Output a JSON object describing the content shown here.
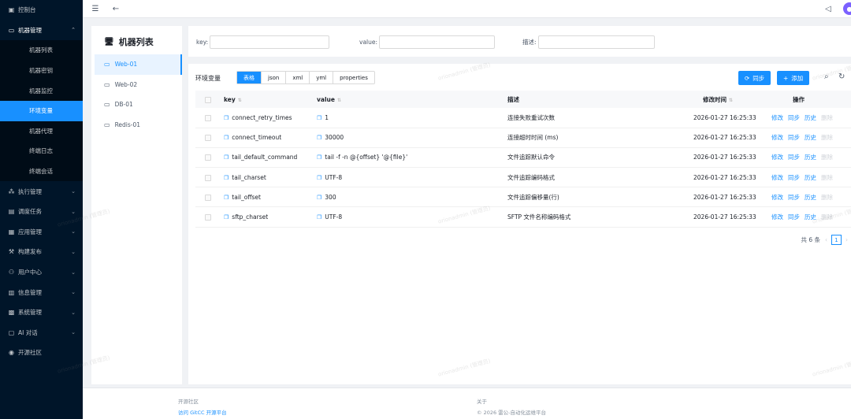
{
  "sidebar": {
    "items": [
      {
        "icon": "dashboard-icon",
        "label": "控制台"
      },
      {
        "icon": "desktop-icon",
        "label": "机器管理",
        "open": true,
        "children": [
          {
            "label": "机器列表"
          },
          {
            "label": "机器密钥"
          },
          {
            "label": "机器监控"
          },
          {
            "label": "环境变量",
            "active": true
          },
          {
            "label": "机器代理"
          },
          {
            "label": "终端日志"
          },
          {
            "label": "终端会话"
          }
        ]
      },
      {
        "icon": "cluster-icon",
        "label": "执行管理"
      },
      {
        "icon": "schedule-icon",
        "label": "调度任务"
      },
      {
        "icon": "app-icon",
        "label": "应用管理"
      },
      {
        "icon": "build-icon",
        "label": "构建发布"
      },
      {
        "icon": "user-icon",
        "label": "用户中心"
      },
      {
        "icon": "info-icon",
        "label": "信息管理"
      },
      {
        "icon": "system-icon",
        "label": "系统管理"
      },
      {
        "icon": "ai-chat-icon",
        "label": "AI 对话"
      },
      {
        "icon": "github-icon",
        "label": "开源社区"
      }
    ]
  },
  "machine_panel": {
    "title": "机器列表",
    "machines": [
      {
        "name": "Web-01",
        "active": true
      },
      {
        "name": "Web-02"
      },
      {
        "name": "DB-01"
      },
      {
        "name": "Redis-01"
      }
    ]
  },
  "search": {
    "key_label": "key:",
    "key_value": "",
    "value_label": "value:",
    "value_value": "",
    "desc_label": "描述:",
    "desc_value": ""
  },
  "table_panel": {
    "title": "环境变量",
    "view_modes": [
      "表格",
      "json",
      "xml",
      "yml",
      "properties"
    ],
    "active_mode": "表格",
    "sync_label": "同步",
    "add_label": "添加",
    "columns": {
      "key": "key",
      "value": "value",
      "desc": "描述",
      "time": "修改时间",
      "ops": "操作"
    },
    "rows": [
      {
        "key": "connect_retry_times",
        "value": "1",
        "desc": "连接失败重试次数",
        "time": "2026-01-27 16:25:33"
      },
      {
        "key": "connect_timeout",
        "value": "30000",
        "desc": "连接超时时间 (ms)",
        "time": "2026-01-27 16:25:33"
      },
      {
        "key": "tail_default_command",
        "value": "tail -f -n @{offset} '@{file}'",
        "desc": "文件追踪默认命令",
        "time": "2026-01-27 16:25:33"
      },
      {
        "key": "tail_charset",
        "value": "UTF-8",
        "desc": "文件追踪编码格式",
        "time": "2026-01-27 16:25:33"
      },
      {
        "key": "tail_offset",
        "value": "300",
        "desc": "文件追踪偏移量(行)",
        "time": "2026-01-27 16:25:33"
      },
      {
        "key": "sftp_charset",
        "value": "UTF-8",
        "desc": "SFTP 文件名称编码格式",
        "time": "2026-01-27 16:25:33"
      }
    ],
    "actions": [
      "修改",
      "同步",
      "历史",
      "删除"
    ],
    "pagination": {
      "total_text": "共 6 条",
      "current_page": "1"
    }
  },
  "footer": {
    "community_title": "开源社区",
    "community_link": "访问 GitCC 开源平台",
    "about_title": "关于",
    "copyright": "© 2026 雷公-自动化运维平台"
  },
  "watermark": "orionadmin (管理员)",
  "colors": {
    "primary": "#1890ff",
    "sidebar_bg": "#001529"
  }
}
